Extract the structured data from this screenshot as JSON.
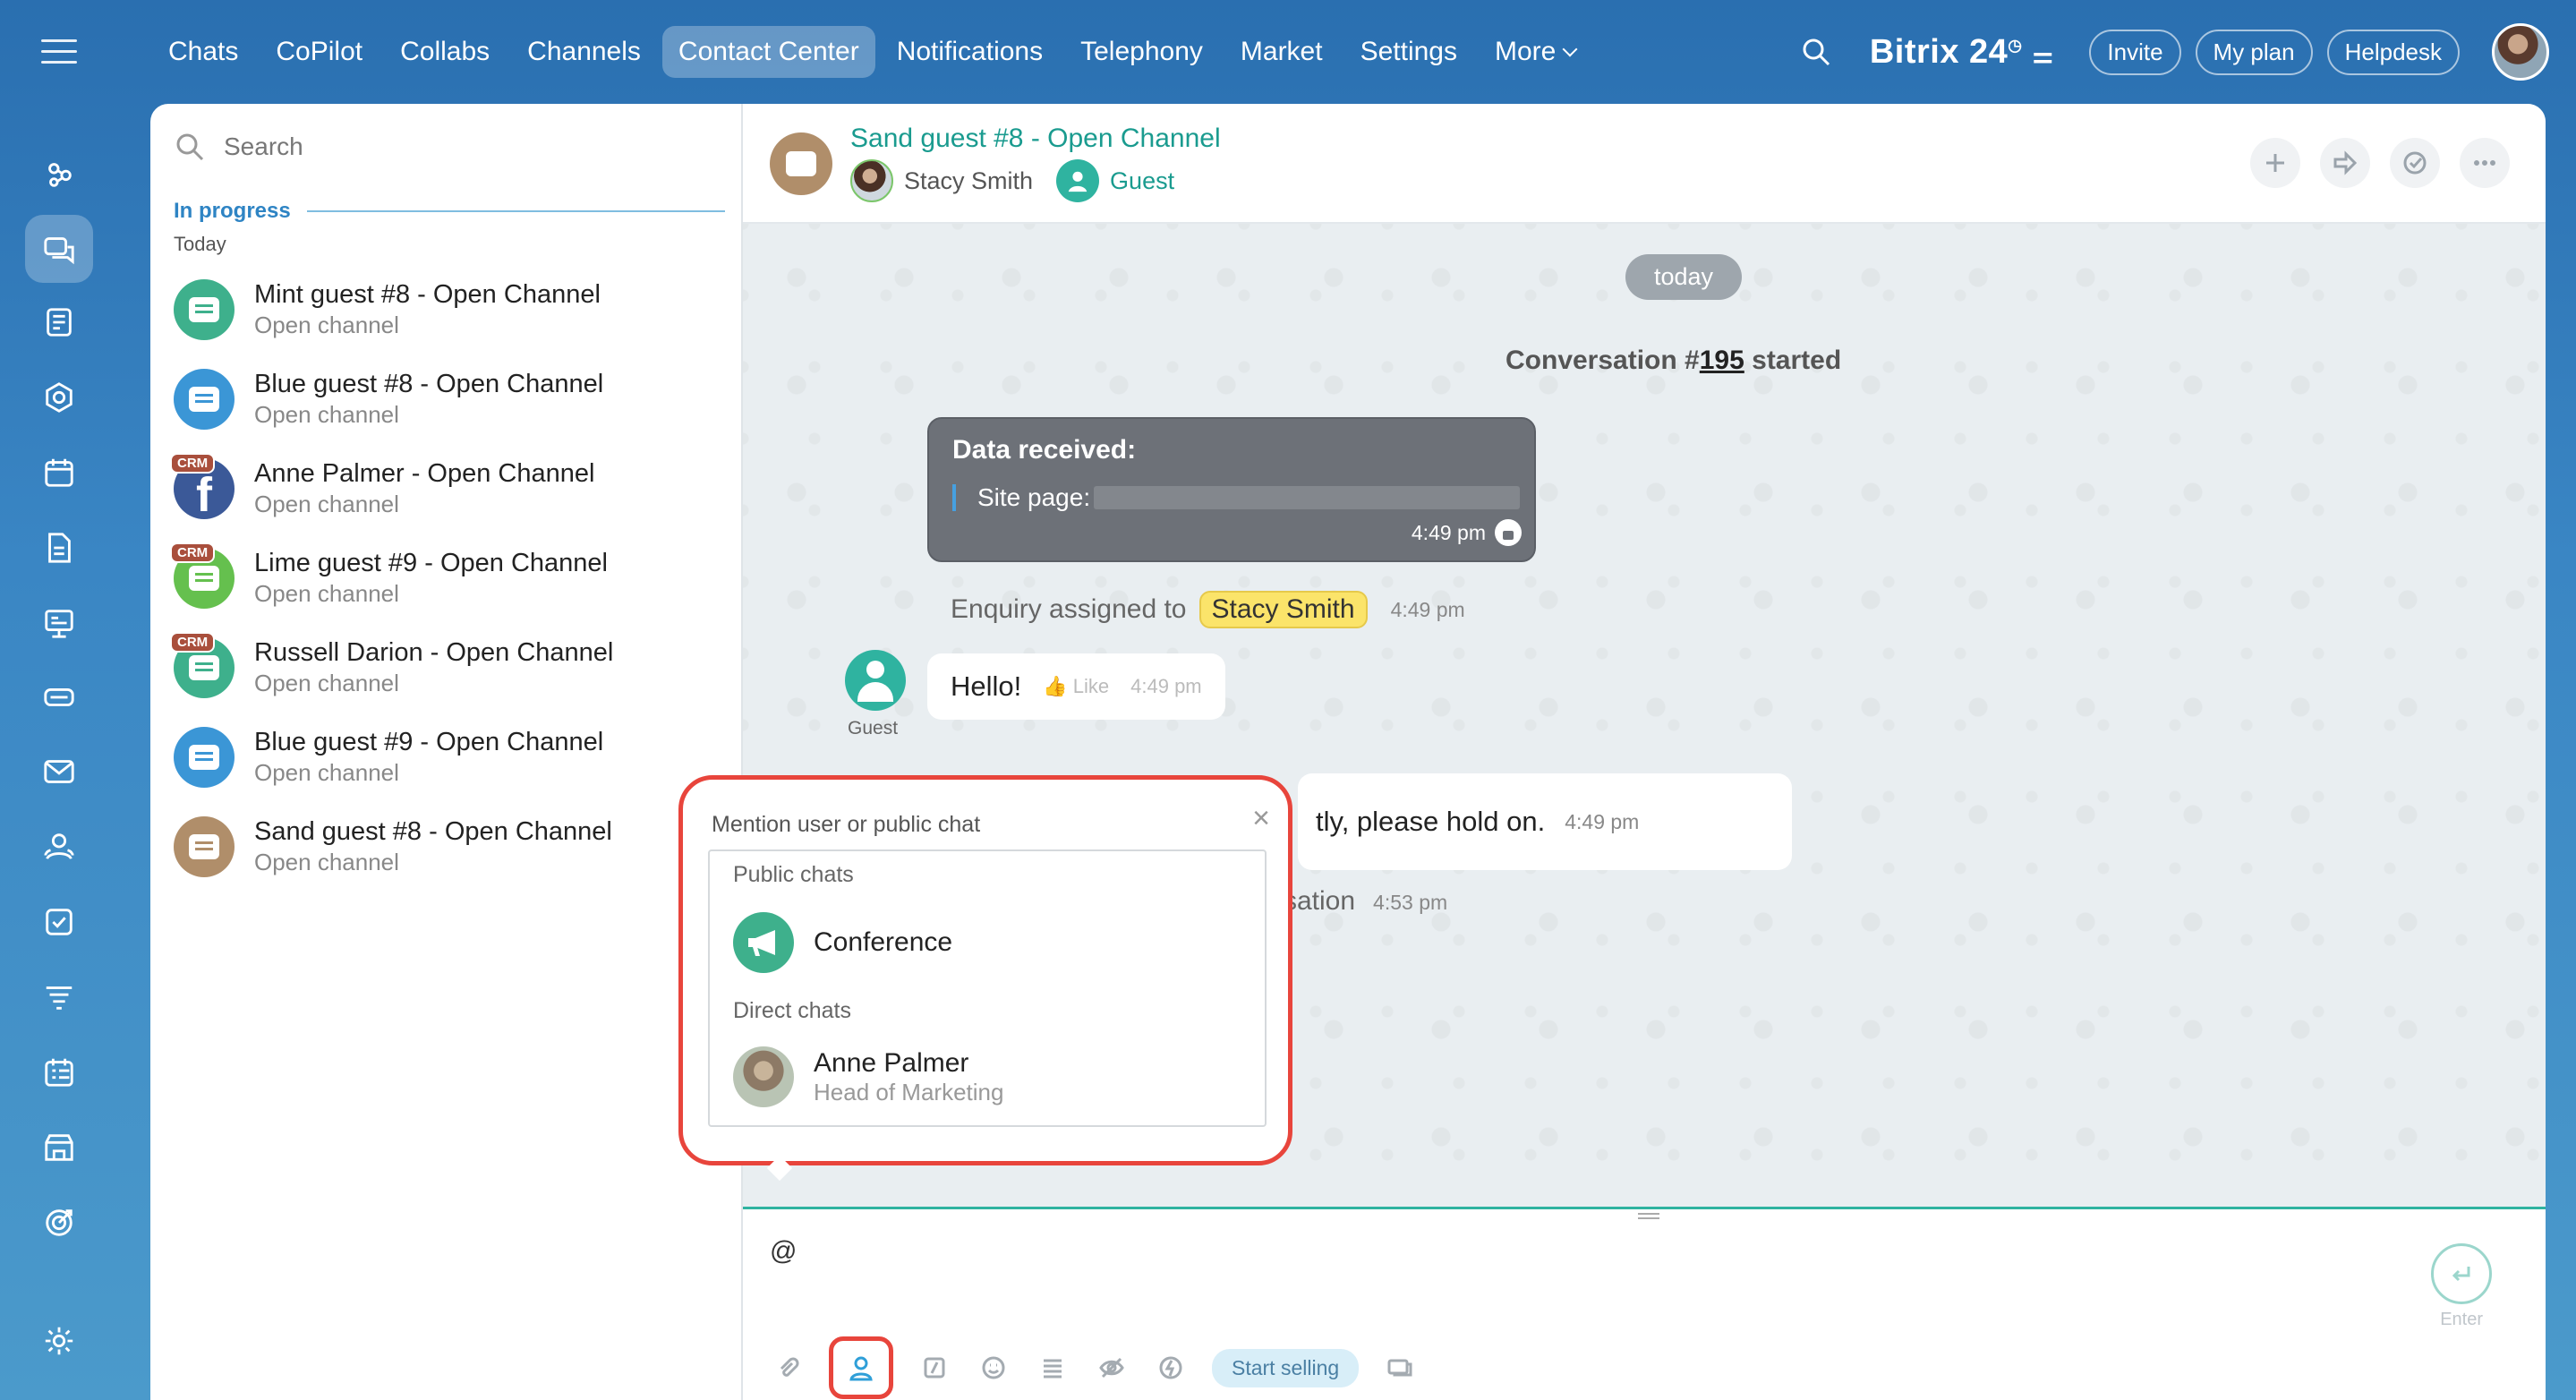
{
  "topnav": {
    "items": [
      "Chats",
      "CoPilot",
      "Collabs",
      "Channels",
      "Contact Center",
      "Notifications",
      "Telephony",
      "Market",
      "Settings",
      "More"
    ],
    "active_index": 4
  },
  "topright": {
    "brand": "Bitrix 24",
    "invite": "Invite",
    "my_plan": "My plan",
    "helpdesk": "Helpdesk"
  },
  "rail": {
    "icons": [
      "menu-icon",
      "funnel-icon",
      "chat-icon",
      "feed-icon",
      "hexagon-icon",
      "calendar-icon",
      "document-icon",
      "presentation-icon",
      "drive-icon",
      "mail-icon",
      "people-icon",
      "tasks-icon",
      "filter-icon",
      "planner-icon",
      "store-icon",
      "goal-icon",
      "settings-icon"
    ]
  },
  "list": {
    "search_placeholder": "Search",
    "section": "In progress",
    "subsection": "Today",
    "chats": [
      {
        "title": "Mint guest #8 - Open Channel",
        "sub": "Open channel",
        "color": "#3eb08c",
        "crm": false
      },
      {
        "title": "Blue guest #8 - Open Channel",
        "sub": "Open channel",
        "color": "#3b96d6",
        "crm": false
      },
      {
        "title": "Anne Palmer - Open Channel",
        "sub": "Open channel",
        "color": "#3b5998",
        "crm": true,
        "icon": "facebook-icon"
      },
      {
        "title": "Lime guest #9 - Open Channel",
        "sub": "Open channel",
        "color": "#65c04e",
        "crm": true
      },
      {
        "title": "Russell Darion - Open Channel",
        "sub": "Open channel",
        "color": "#3eb08c",
        "crm": true
      },
      {
        "title": "Blue guest #9 - Open Channel",
        "sub": "Open channel",
        "color": "#3b96d6",
        "crm": false
      },
      {
        "title": "Sand guest #8 - Open Channel",
        "sub": "Open channel",
        "color": "#b08e6a",
        "crm": false
      }
    ],
    "crm_badge": "CRM"
  },
  "conversation": {
    "title": "Sand guest #8 - Open Channel",
    "operator": "Stacy Smith",
    "guest": "Guest",
    "date_chip": "today",
    "started_prefix": "Conversation #",
    "started_number": "195",
    "started_suffix": " started",
    "data_card": {
      "title": "Data received:",
      "row_label": "Site page:",
      "time": "4:49 pm"
    },
    "assign": {
      "text": "Enquiry assigned to",
      "name": "Stacy Smith",
      "time": "4:49 pm"
    },
    "guest_label": "Guest",
    "hello": {
      "text": "Hello!",
      "like": "Like",
      "time": "4:49 pm"
    },
    "hold": {
      "text": "tly, please hold on.",
      "time": "4:49 pm"
    },
    "conv_line": {
      "text": "rsation",
      "time": "4:53 pm"
    }
  },
  "composer": {
    "value": "@",
    "enter_label": "Enter",
    "start_selling": "Start selling"
  },
  "mention_popup": {
    "title": "Mention user or public chat",
    "public_label": "Public chats",
    "public_items": [
      {
        "name": "Conference"
      }
    ],
    "direct_label": "Direct chats",
    "direct_items": [
      {
        "name": "Anne Palmer",
        "role": "Head of Marketing"
      }
    ]
  }
}
